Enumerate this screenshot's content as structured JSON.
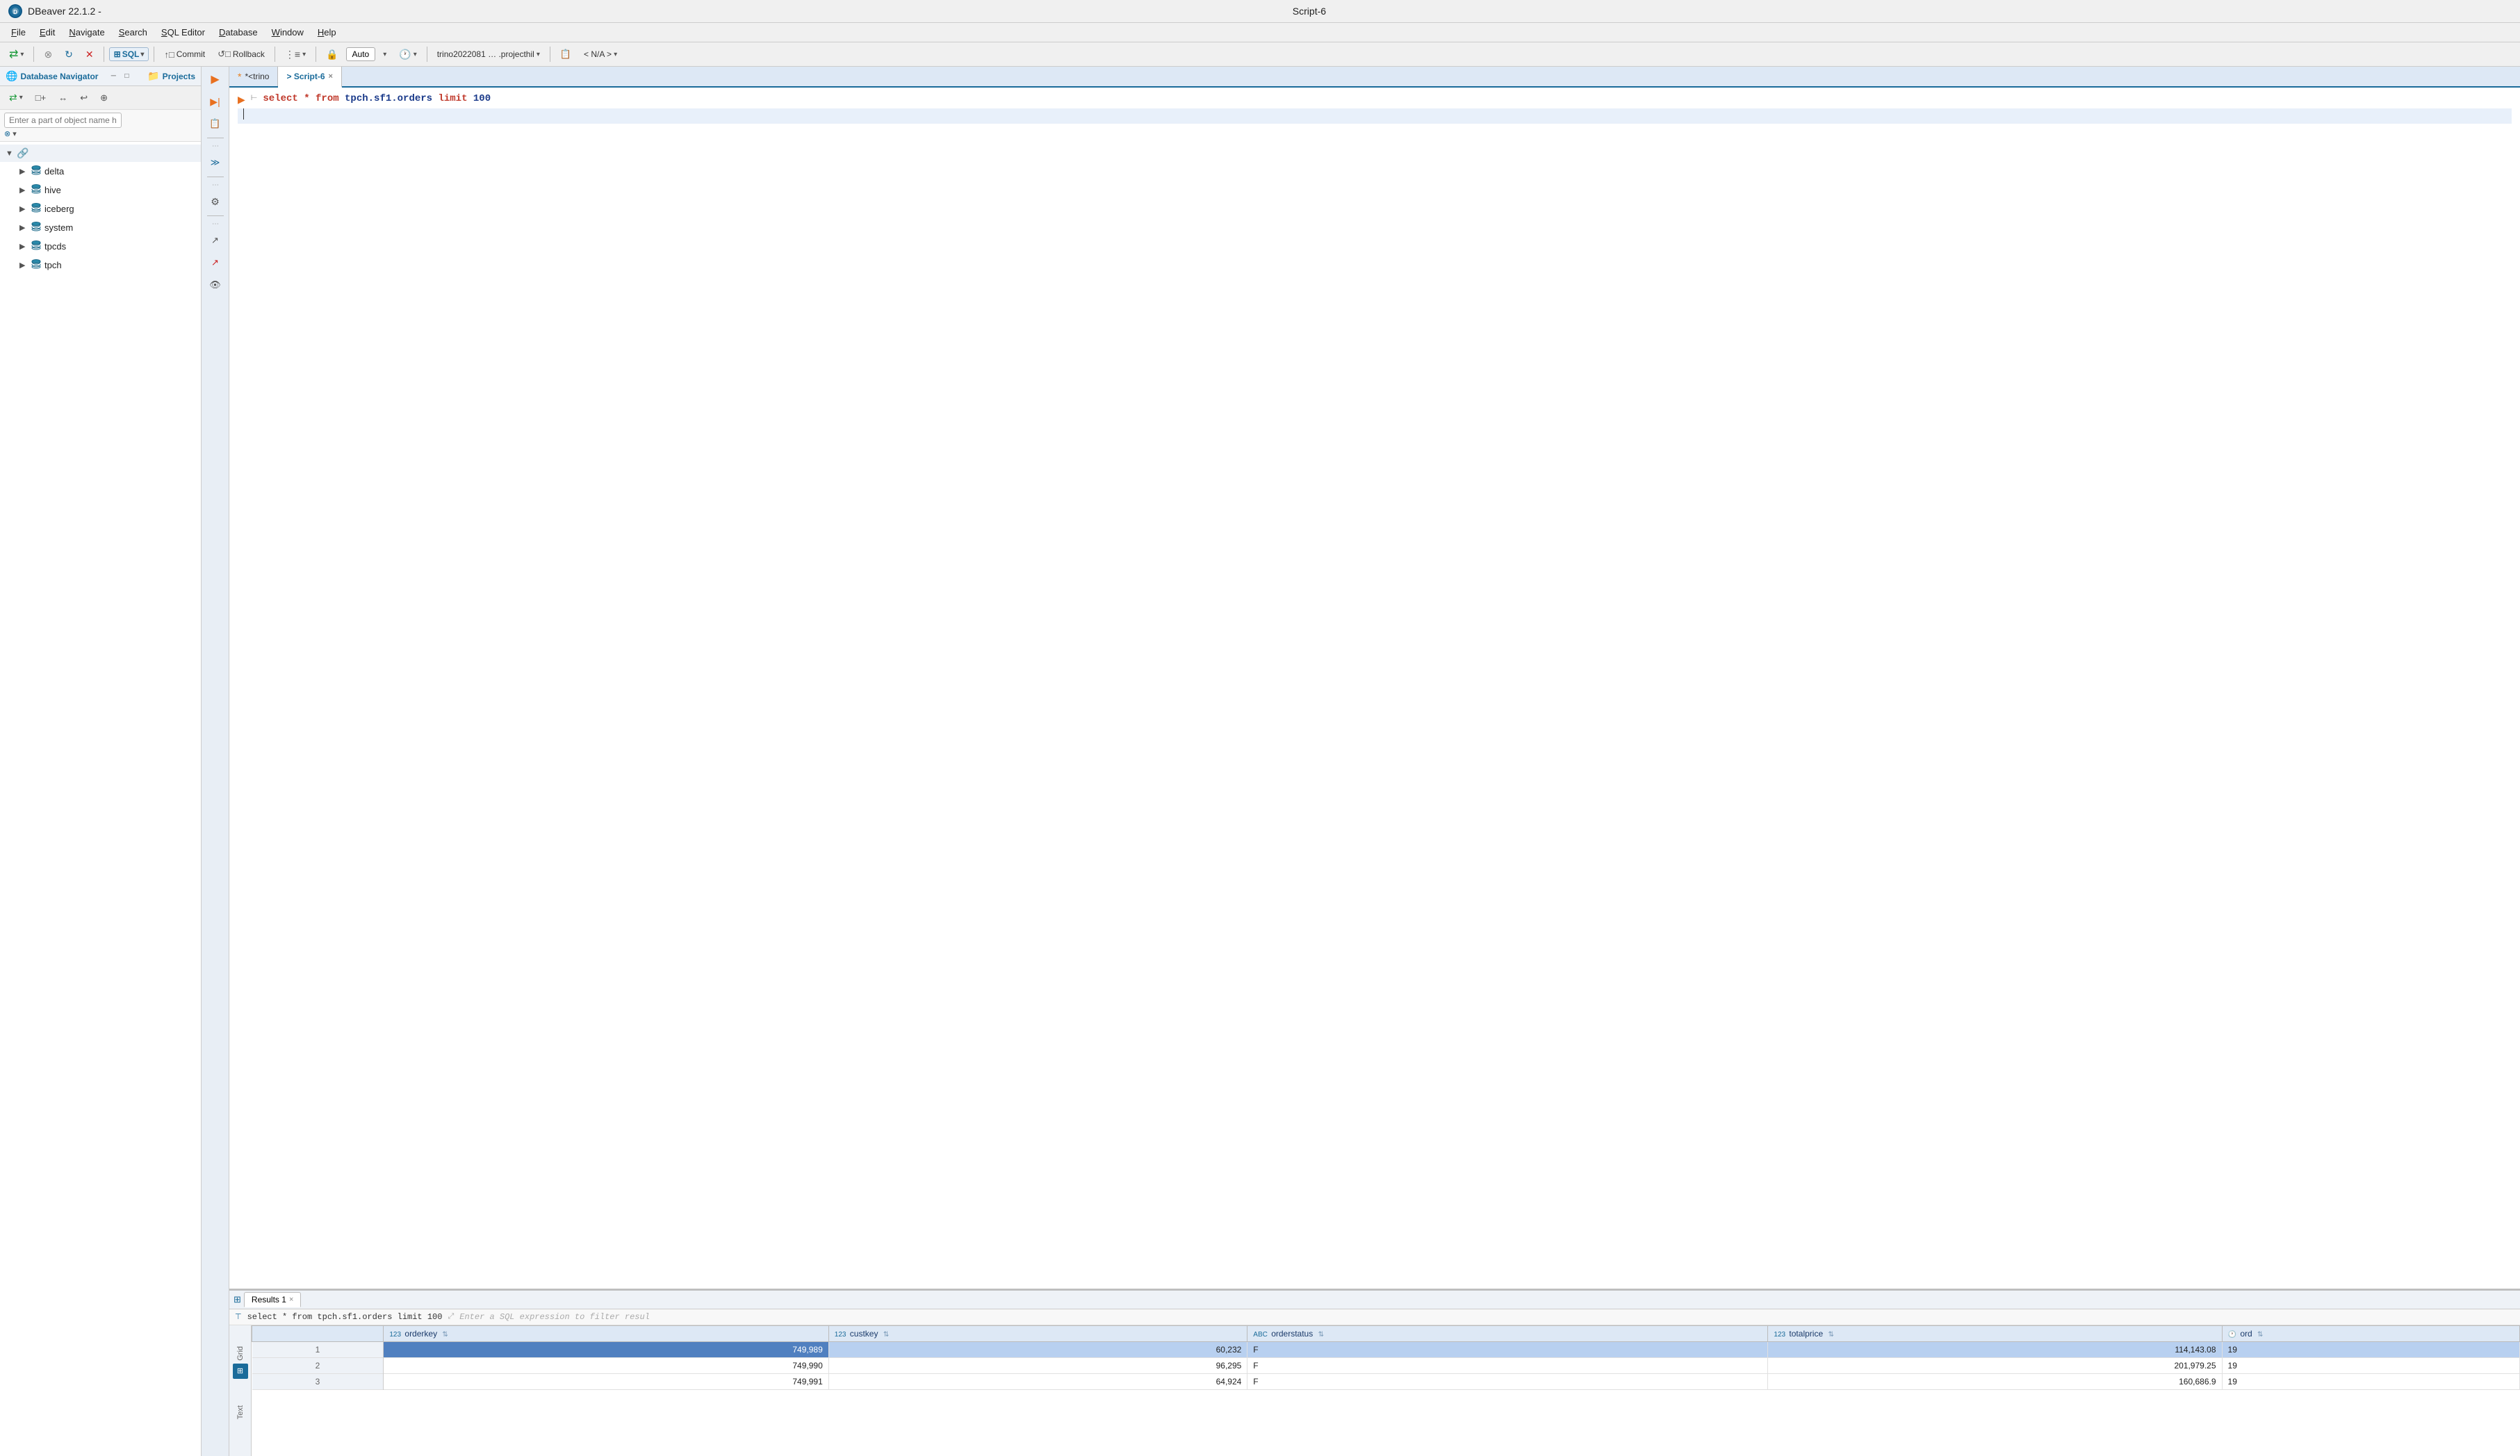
{
  "titleBar": {
    "appName": "DBeaver 22.1.2 -",
    "scriptName": "Script-6",
    "appIconLabel": "D"
  },
  "menuBar": {
    "items": [
      "File",
      "Edit",
      "Navigate",
      "Search",
      "SQL Editor",
      "Database",
      "Window",
      "Help"
    ]
  },
  "toolbar": {
    "sqlLabel": "SQL",
    "commitLabel": "Commit",
    "rollbackLabel": "Rollback",
    "autoLabel": "Auto",
    "connectionLabel": "trino2022081 … .projecthil",
    "naLabel": "< N/A >"
  },
  "leftPanel": {
    "tabDatabase": "Database Navigator",
    "tabProjects": "Projects",
    "searchPlaceholder": "Enter a part of object name here",
    "treeItems": [
      {
        "id": "delta",
        "label": "delta"
      },
      {
        "id": "hive",
        "label": "hive"
      },
      {
        "id": "iceberg",
        "label": "iceberg"
      },
      {
        "id": "system",
        "label": "system"
      },
      {
        "id": "tpcds",
        "label": "tpcds"
      },
      {
        "id": "tpch",
        "label": "tpch"
      }
    ]
  },
  "editorTabs": {
    "trinoTab": "*<trino",
    "scriptTab": "> Script-6"
  },
  "codeEditor": {
    "line1": "select * from tpch.sf1.orders limit 100",
    "selectKw": "select",
    "starKw": "*",
    "fromKw": "from",
    "tableName": "tpch.sf1.orders",
    "limitKw": "limit",
    "limitNum": "100"
  },
  "resultsPanel": {
    "tabLabel": "Results 1",
    "filterQuery": "select * from tpch.sf1.orders limit 100",
    "filterPlaceholder": "Enter a SQL expression to filter resul",
    "columns": [
      {
        "type": "123",
        "name": "orderkey"
      },
      {
        "type": "123",
        "name": "custkey"
      },
      {
        "type": "ABC",
        "name": "orderstatus"
      },
      {
        "type": "123",
        "name": "totalprice"
      },
      {
        "type": "clock",
        "name": "ord"
      }
    ],
    "rows": [
      {
        "rowNum": 1,
        "orderkey": "749,989",
        "custkey": "60,232",
        "orderstatus": "F",
        "totalprice": "114,143.08",
        "ord": "19",
        "selected": true
      },
      {
        "rowNum": 2,
        "orderkey": "749,990",
        "custkey": "96,295",
        "orderstatus": "F",
        "totalprice": "201,979.25",
        "ord": "19",
        "selected": false
      },
      {
        "rowNum": 3,
        "orderkey": "749,991",
        "custkey": "64,924",
        "orderstatus": "F",
        "totalprice": "160,686.9",
        "ord": "19",
        "selected": false
      }
    ]
  },
  "icons": {
    "expand": "▶",
    "expandDown": "▼",
    "close": "×",
    "chevronDown": "▾",
    "run": "▶",
    "runArrow": "▶",
    "dbCylinder": "🗄",
    "filter": "⊗",
    "grid": "⊞",
    "text": "T",
    "lock": "🔒",
    "refresh": "↻",
    "settings": "⚙",
    "back": "◀"
  }
}
